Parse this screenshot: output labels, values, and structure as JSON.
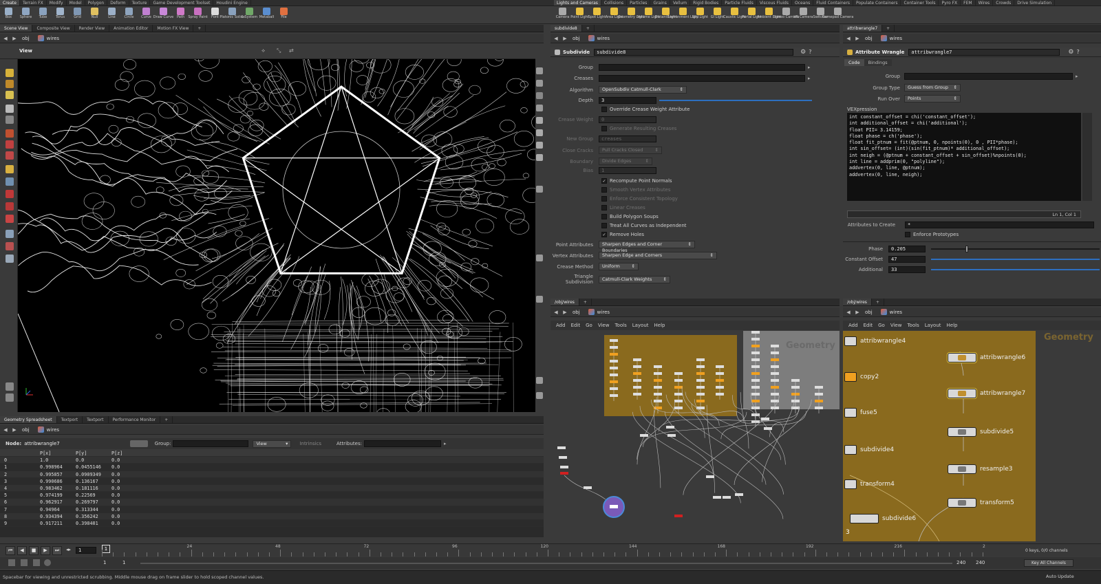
{
  "shelf_tabs_left": [
    "Create",
    "Terrain FX",
    "Modify",
    "Model",
    "Polygon",
    "Deform",
    "Texture",
    "Game Development Toolset",
    "Houdini Engine"
  ],
  "shelf_tabs_right": [
    "Lights and Cameras",
    "Collisions",
    "Particles",
    "Grains",
    "Vellum",
    "Rigid Bodies",
    "Particle Fluids",
    "Viscous Fluids",
    "Oceans",
    "Fluid Containers",
    "Populate Containers",
    "Container Tools",
    "Pyro FX",
    "FEM",
    "Wires",
    "Crowds",
    "Drive Simulation"
  ],
  "tools_left": [
    {
      "label": "Box",
      "color": "#9ab0c8"
    },
    {
      "label": "Sphere",
      "color": "#8fa6c2"
    },
    {
      "label": "Tube",
      "color": "#8aa2be"
    },
    {
      "label": "Torus",
      "color": "#a0b4cc"
    },
    {
      "label": "Grid",
      "color": "#7f97b3"
    },
    {
      "label": "Null",
      "color": "#e0c060"
    },
    {
      "label": "Line",
      "color": "#9cb0c8"
    },
    {
      "label": "Circle",
      "color": "#8ea4be"
    },
    {
      "label": "Curve",
      "color": "#c080d0"
    },
    {
      "label": "Draw Curve",
      "color": "#c888d8"
    },
    {
      "label": "Path",
      "color": "#d07ac8"
    },
    {
      "label": "Spray Paint",
      "color": "#c870c0"
    },
    {
      "label": "Font",
      "color": "#dddddd"
    },
    {
      "label": "Platonic Solids",
      "color": "#8aa2be"
    },
    {
      "label": "L-System",
      "color": "#70a868"
    },
    {
      "label": "Metaball",
      "color": "#5a8ed0"
    },
    {
      "label": "File",
      "color": "#e07040"
    }
  ],
  "tools_right": [
    {
      "label": "Camera",
      "color": "#aaaaaa"
    },
    {
      "label": "Point Light",
      "color": "#e8c040"
    },
    {
      "label": "Spot Light",
      "color": "#e8c040"
    },
    {
      "label": "Area Light",
      "color": "#e8c040"
    },
    {
      "label": "Geometry Light",
      "color": "#e8c040"
    },
    {
      "label": "Volume Light",
      "color": "#e8c040"
    },
    {
      "label": "Distant Light",
      "color": "#e8c040"
    },
    {
      "label": "Environment Light",
      "color": "#e8c040"
    },
    {
      "label": "Sky Light",
      "color": "#e8c040"
    },
    {
      "label": "GI Light",
      "color": "#e8c040"
    },
    {
      "label": "Caustic Light",
      "color": "#e8c040"
    },
    {
      "label": "Portal Light",
      "color": "#e8c040"
    },
    {
      "label": "Ambient Light",
      "color": "#e8c040"
    },
    {
      "label": "Stereo Camera",
      "color": "#aaaaaa"
    },
    {
      "label": "VR Camera",
      "color": "#aaaaaa"
    },
    {
      "label": "Switcher",
      "color": "#aaaaaa"
    },
    {
      "label": "Gamepad Camera",
      "color": "#aaaaaa"
    }
  ],
  "left_pane": {
    "tabs": [
      "Scene View",
      "Composite View",
      "Render View",
      "Animation Editor",
      "Motion FX View"
    ],
    "path": {
      "obj": "obj",
      "net": "wires"
    },
    "viewport_label": "View"
  },
  "spreadsheet": {
    "tabs": [
      "Geometry Spreadsheet",
      "Textport",
      "Textport",
      "Performance Monitor"
    ],
    "path": {
      "obj": "obj",
      "net": "wires"
    },
    "node_label": "Node:",
    "node_name": "attribwrangle7",
    "group_label": "Group:",
    "view_label": "View",
    "intrinsics_label": "Intrinsics",
    "attributes_label": "Attributes:",
    "columns": [
      "",
      "P[x]",
      "P[y]",
      "P[z]"
    ],
    "rows": [
      [
        "0",
        "1.0",
        "0.0",
        "0.0"
      ],
      [
        "1",
        "0.998964",
        "0.0455146",
        "0.0"
      ],
      [
        "2",
        "0.995857",
        "0.0909349",
        "0.0"
      ],
      [
        "3",
        "0.990686",
        "0.136167",
        "0.0"
      ],
      [
        "4",
        "0.983462",
        "0.181116",
        "0.0"
      ],
      [
        "5",
        "0.974199",
        "0.22569",
        "0.0"
      ],
      [
        "6",
        "0.962917",
        "0.269797",
        "0.0"
      ],
      [
        "7",
        "0.94964",
        "0.313344",
        "0.0"
      ],
      [
        "8",
        "0.934394",
        "0.356242",
        "0.0"
      ],
      [
        "9",
        "0.917211",
        "0.398401",
        "0.0"
      ]
    ]
  },
  "subdivide_pane": {
    "tab": "subdivide8",
    "path": {
      "obj": "obj",
      "net": "wires"
    },
    "type_label": "Subdivide",
    "node_name": "subdivide8",
    "params": {
      "group": "Group",
      "creases": "Creases",
      "algorithm": "Algorithm",
      "algorithm_val": "OpenSubdiv Catmull-Clark",
      "depth": "Depth",
      "depth_val": "3",
      "override": "Override Crease Weight Attribute",
      "crease_weight": "Crease Weight",
      "crease_weight_val": "0",
      "gen_creases": "Generate Resulting Creases",
      "new_group": "New Group",
      "new_group_val": "creases",
      "close_cracks": "Close Cracks",
      "close_cracks_val": "Pull Cracks Closed",
      "boundary": "Boundary",
      "boundary_val": "Divide Edges",
      "bias": "Bias",
      "bias_val": "1",
      "recompute": "Recompute Point Normals",
      "smooth_vertex": "Smooth Vertex Attributes",
      "enforce_topo": "Enforce Consistent Topology",
      "linear_creases": "Linear Creases",
      "build_soups": "Build Polygon Soups",
      "treat_curves": "Treat All Curves as Independent",
      "remove_holes": "Remove Holes",
      "point_attr": "Point Attributes",
      "point_attr_val": "Sharpen Edges and Corner Boundaries",
      "vertex_attr": "Vertex Attributes",
      "vertex_attr_val": "Sharpen Edge and Corners",
      "crease_method": "Crease Method",
      "crease_method_val": "Uniform",
      "tri_sub": "Triangle Subdivision",
      "tri_sub_val": "Catmull-Clark Weights"
    }
  },
  "wrangle_pane": {
    "tab": "attribwrangle7",
    "path": {
      "obj": "obj",
      "net": "wires"
    },
    "type_label": "Attribute Wrangle",
    "node_name": "attribwrangle7",
    "subtabs": [
      "Code",
      "Bindings"
    ],
    "group": "Group",
    "group_type": "Group Type",
    "group_type_val": "Guess from Group",
    "run_over": "Run Over",
    "run_over_val": "Points",
    "vex_label": "VEXpression",
    "code": [
      "int constant_offset = chi('constant_offset');",
      "int additional_offset = chi('additional');",
      "float PII= 3.14159;",
      "float phase = ch('phase');",
      "",
      "float fit_ptnum = fit(@ptnum, 0, npoints(0), 0 , PII*phase);",
      "int sin_offset= (int)(sin(fit_ptnum)* additional_offset);",
      "",
      "int neigh = (@ptnum + constant_offset + sin_offset)%npoints(0);",
      "",
      "int line = addprim(0, \"polyline\");",
      "addvertex(0, line, @ptnum);",
      "addvertex(0, line, neigh);"
    ],
    "cursor": "Ln 1, Col 1",
    "attr_create": "Attributes to Create",
    "attr_create_val": "*",
    "enforce_proto": "Enforce Prototypes",
    "phase": "Phase",
    "phase_val": "0.205",
    "phase_frac": 0.205,
    "const_offset": "Constant Offset",
    "const_offset_val": "47",
    "additional": "Additional",
    "additional_val": "33"
  },
  "net_left": {
    "tab": "/obj/wires",
    "path": {
      "obj": "obj",
      "net": "wires"
    },
    "menu": [
      "Add",
      "Edit",
      "Go",
      "View",
      "Tools",
      "Layout",
      "Help"
    ],
    "watermark": "Geometry"
  },
  "net_right": {
    "tab": "/obj/wires",
    "path": {
      "obj": "obj",
      "net": "wires"
    },
    "menu": [
      "Add",
      "Edit",
      "Go",
      "View",
      "Tools",
      "Layout",
      "Help"
    ],
    "watermark": "Geometry",
    "nodes_left": [
      "attribwrangle4",
      "copy2",
      "fuse5",
      "subdivide4",
      "transform4",
      "subdivide6"
    ],
    "nodes_right": [
      "attribwrangle6",
      "attribwrangle7",
      "subdivide5",
      "resample3",
      "transform5"
    ],
    "count": "3"
  },
  "timeline": {
    "frame": "1",
    "start": "1",
    "start2": "1",
    "end": "240",
    "end2": "240",
    "ticks": [
      "24",
      "48",
      "72",
      "96",
      "120",
      "144",
      "168",
      "192",
      "216",
      "2"
    ],
    "keys": "0 keys, 0/0 channels",
    "key_all": "Key All Channels",
    "auto_update": "Auto Update"
  },
  "status": "Spacebar for viewing and unrestricted scrubbing. Middle mouse drag on frame slider to hold scoped channel values.",
  "colors": {
    "network_box": "#8a6a1e",
    "network_box_gray": "#7d7d7d",
    "accent_blue": "#2d6fc0"
  }
}
